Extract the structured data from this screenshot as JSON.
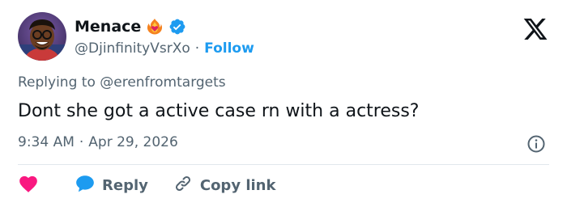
{
  "user": {
    "display_name": "Menace",
    "handle": "@DjinfinityVsrXo",
    "separator": "·",
    "follow_label": "Follow",
    "emoji_icon": "heart-on-fire-emoji",
    "verified_icon": "verified-badge-icon"
  },
  "reply_context": "Replying to @erenfromtargets",
  "tweet": {
    "text": "Dont she got a active case rn with a actress?",
    "time": "9:34 AM",
    "separator": "·",
    "date": "Apr 29, 2026"
  },
  "actions": {
    "reply_label": "Reply",
    "copy_link_label": "Copy link"
  },
  "colors": {
    "accent": "#1d9bf0",
    "heart": "#f91880",
    "text_primary": "#0f1419",
    "text_secondary": "#536471",
    "divider": "#e1e8ed"
  }
}
